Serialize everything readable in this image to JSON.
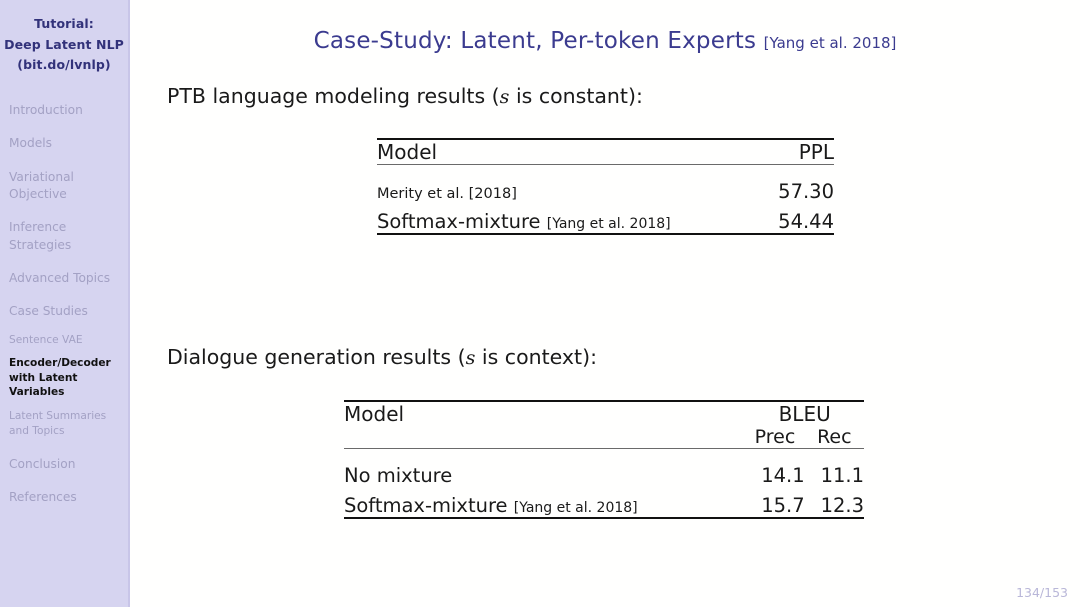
{
  "sidebar": {
    "title_lines": [
      "Tutorial:",
      "Deep Latent NLP",
      "(bit.do/lvnlp)"
    ],
    "items": [
      {
        "label": "Introduction",
        "level": "section",
        "active": false
      },
      {
        "label": "Models",
        "level": "section",
        "active": false
      },
      {
        "label": "Variational Objective",
        "level": "section",
        "active": false
      },
      {
        "label": "Inference Strategies",
        "level": "section",
        "active": false
      },
      {
        "label": "Advanced Topics",
        "level": "section",
        "active": false
      },
      {
        "label": "Case Studies",
        "level": "section",
        "active": false
      },
      {
        "label": "Sentence VAE",
        "level": "subsection",
        "active": false
      },
      {
        "label": "Encoder/Decoder with Latent Variables",
        "level": "subsection",
        "active": true
      },
      {
        "label": "Latent Summaries and Topics",
        "level": "subsection",
        "active": false
      },
      {
        "label": "Conclusion",
        "level": "section",
        "active": false
      },
      {
        "label": "References",
        "level": "section",
        "active": false
      }
    ]
  },
  "slide": {
    "title": "Case-Study: Latent, Per-token Experts",
    "title_citation": "[Yang et al. 2018]",
    "page_number": "134/153",
    "colors": {
      "sidebar_bg": "#d6d4f0",
      "title_color": "#3b3b8f",
      "sidebar_title_color": "#32327a",
      "sidebar_inactive": "#a3a1c4",
      "sidebar_active": "#111111",
      "page_number_color": "#b9b7d8"
    }
  },
  "section_ppl": {
    "lead_before": "PTB language modeling results (",
    "lead_var": "s",
    "lead_after": " is constant):",
    "table": {
      "columns": [
        "Model",
        "PPL"
      ],
      "rows": [
        {
          "model": "Merity et al. [2018]",
          "citation": "",
          "small": true,
          "ppl": "57.30"
        },
        {
          "model": "Softmax-mixture",
          "citation": "[Yang et al. 2018]",
          "small": false,
          "ppl": "54.44"
        }
      ]
    }
  },
  "section_bleu": {
    "lead_before": "Dialogue generation results (",
    "lead_var": "s",
    "lead_after": " is context):",
    "table": {
      "columns": [
        "Model",
        "BLEU"
      ],
      "subcolumns": [
        "Prec",
        "Rec"
      ],
      "rows": [
        {
          "model": "No mixture",
          "citation": "",
          "prec": "14.1",
          "rec": "11.1"
        },
        {
          "model": "Softmax-mixture",
          "citation": "[Yang et al. 2018]",
          "prec": "15.7",
          "rec": "12.3"
        }
      ]
    }
  }
}
